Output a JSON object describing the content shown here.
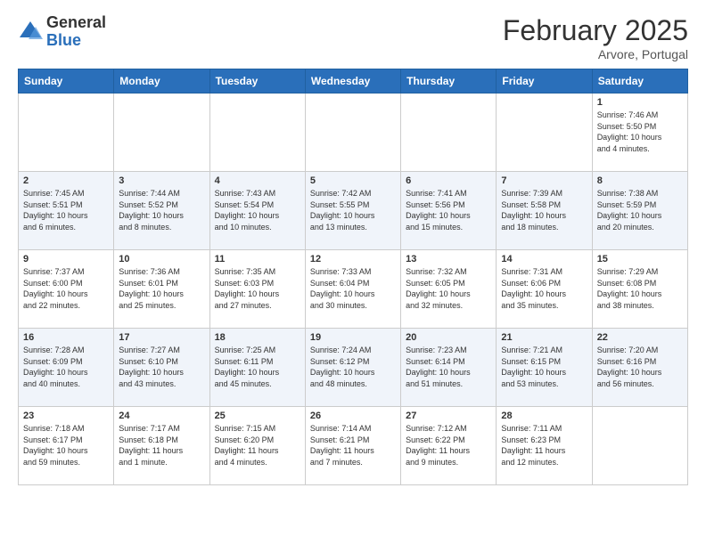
{
  "header": {
    "logo_general": "General",
    "logo_blue": "Blue",
    "month_title": "February 2025",
    "location": "Arvore, Portugal"
  },
  "weekdays": [
    "Sunday",
    "Monday",
    "Tuesday",
    "Wednesday",
    "Thursday",
    "Friday",
    "Saturday"
  ],
  "weeks": [
    [
      {
        "day": "",
        "info": ""
      },
      {
        "day": "",
        "info": ""
      },
      {
        "day": "",
        "info": ""
      },
      {
        "day": "",
        "info": ""
      },
      {
        "day": "",
        "info": ""
      },
      {
        "day": "",
        "info": ""
      },
      {
        "day": "1",
        "info": "Sunrise: 7:46 AM\nSunset: 5:50 PM\nDaylight: 10 hours\nand 4 minutes."
      }
    ],
    [
      {
        "day": "2",
        "info": "Sunrise: 7:45 AM\nSunset: 5:51 PM\nDaylight: 10 hours\nand 6 minutes."
      },
      {
        "day": "3",
        "info": "Sunrise: 7:44 AM\nSunset: 5:52 PM\nDaylight: 10 hours\nand 8 minutes."
      },
      {
        "day": "4",
        "info": "Sunrise: 7:43 AM\nSunset: 5:54 PM\nDaylight: 10 hours\nand 10 minutes."
      },
      {
        "day": "5",
        "info": "Sunrise: 7:42 AM\nSunset: 5:55 PM\nDaylight: 10 hours\nand 13 minutes."
      },
      {
        "day": "6",
        "info": "Sunrise: 7:41 AM\nSunset: 5:56 PM\nDaylight: 10 hours\nand 15 minutes."
      },
      {
        "day": "7",
        "info": "Sunrise: 7:39 AM\nSunset: 5:58 PM\nDaylight: 10 hours\nand 18 minutes."
      },
      {
        "day": "8",
        "info": "Sunrise: 7:38 AM\nSunset: 5:59 PM\nDaylight: 10 hours\nand 20 minutes."
      }
    ],
    [
      {
        "day": "9",
        "info": "Sunrise: 7:37 AM\nSunset: 6:00 PM\nDaylight: 10 hours\nand 22 minutes."
      },
      {
        "day": "10",
        "info": "Sunrise: 7:36 AM\nSunset: 6:01 PM\nDaylight: 10 hours\nand 25 minutes."
      },
      {
        "day": "11",
        "info": "Sunrise: 7:35 AM\nSunset: 6:03 PM\nDaylight: 10 hours\nand 27 minutes."
      },
      {
        "day": "12",
        "info": "Sunrise: 7:33 AM\nSunset: 6:04 PM\nDaylight: 10 hours\nand 30 minutes."
      },
      {
        "day": "13",
        "info": "Sunrise: 7:32 AM\nSunset: 6:05 PM\nDaylight: 10 hours\nand 32 minutes."
      },
      {
        "day": "14",
        "info": "Sunrise: 7:31 AM\nSunset: 6:06 PM\nDaylight: 10 hours\nand 35 minutes."
      },
      {
        "day": "15",
        "info": "Sunrise: 7:29 AM\nSunset: 6:08 PM\nDaylight: 10 hours\nand 38 minutes."
      }
    ],
    [
      {
        "day": "16",
        "info": "Sunrise: 7:28 AM\nSunset: 6:09 PM\nDaylight: 10 hours\nand 40 minutes."
      },
      {
        "day": "17",
        "info": "Sunrise: 7:27 AM\nSunset: 6:10 PM\nDaylight: 10 hours\nand 43 minutes."
      },
      {
        "day": "18",
        "info": "Sunrise: 7:25 AM\nSunset: 6:11 PM\nDaylight: 10 hours\nand 45 minutes."
      },
      {
        "day": "19",
        "info": "Sunrise: 7:24 AM\nSunset: 6:12 PM\nDaylight: 10 hours\nand 48 minutes."
      },
      {
        "day": "20",
        "info": "Sunrise: 7:23 AM\nSunset: 6:14 PM\nDaylight: 10 hours\nand 51 minutes."
      },
      {
        "day": "21",
        "info": "Sunrise: 7:21 AM\nSunset: 6:15 PM\nDaylight: 10 hours\nand 53 minutes."
      },
      {
        "day": "22",
        "info": "Sunrise: 7:20 AM\nSunset: 6:16 PM\nDaylight: 10 hours\nand 56 minutes."
      }
    ],
    [
      {
        "day": "23",
        "info": "Sunrise: 7:18 AM\nSunset: 6:17 PM\nDaylight: 10 hours\nand 59 minutes."
      },
      {
        "day": "24",
        "info": "Sunrise: 7:17 AM\nSunset: 6:18 PM\nDaylight: 11 hours\nand 1 minute."
      },
      {
        "day": "25",
        "info": "Sunrise: 7:15 AM\nSunset: 6:20 PM\nDaylight: 11 hours\nand 4 minutes."
      },
      {
        "day": "26",
        "info": "Sunrise: 7:14 AM\nSunset: 6:21 PM\nDaylight: 11 hours\nand 7 minutes."
      },
      {
        "day": "27",
        "info": "Sunrise: 7:12 AM\nSunset: 6:22 PM\nDaylight: 11 hours\nand 9 minutes."
      },
      {
        "day": "28",
        "info": "Sunrise: 7:11 AM\nSunset: 6:23 PM\nDaylight: 11 hours\nand 12 minutes."
      },
      {
        "day": "",
        "info": ""
      }
    ]
  ]
}
